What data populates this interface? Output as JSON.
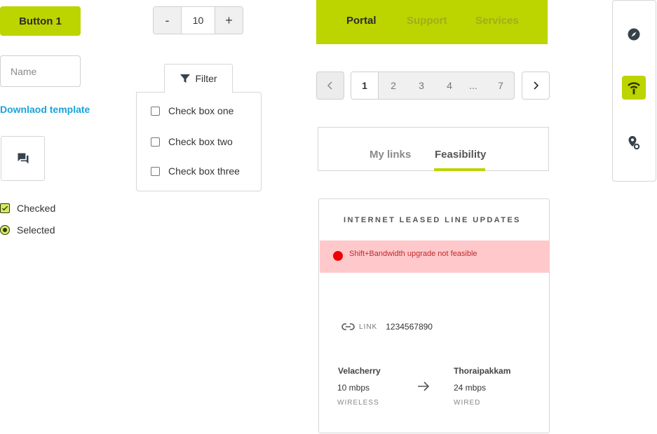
{
  "buttons": {
    "button1": "Button 1"
  },
  "name_field": {
    "placeholder": "Name",
    "value": ""
  },
  "download_link": "Downlaod template",
  "checkbox": {
    "label": "Checked",
    "checked": true
  },
  "radio": {
    "label": "Selected",
    "selected": true
  },
  "stepper": {
    "minus": "-",
    "value": "10",
    "plus": "+"
  },
  "filter": {
    "label": "Filter",
    "options": [
      {
        "label": "Check box one",
        "checked": false
      },
      {
        "label": "Check box two",
        "checked": false
      },
      {
        "label": "Check box three",
        "checked": false
      }
    ]
  },
  "topnav": {
    "items": [
      "Portal",
      "Support",
      "Services"
    ],
    "active": "Portal"
  },
  "pagination": {
    "pages": [
      "1",
      "2",
      "3",
      "4",
      "...",
      "7"
    ],
    "current": "1"
  },
  "tabs": {
    "items": [
      "My links",
      "Feasibility"
    ],
    "active": "Feasibility"
  },
  "card": {
    "title": "INTERNET LEASED LINE UPDATES",
    "alert": "Shift+Bandwidth upgrade not feasible",
    "link_label": "LINK",
    "link_number": "1234567890",
    "from": {
      "name": "Velacherry",
      "speed": "10 mbps",
      "type": "WIRELESS"
    },
    "to": {
      "name": "Thoraipakkam",
      "speed": "24 mbps",
      "type": "WIRED"
    }
  },
  "sidebar": {
    "icons": [
      "compass-icon",
      "wifi-signal-icon",
      "location-pin-icon"
    ],
    "active": "wifi-signal-icon"
  },
  "colors": {
    "accent": "#bcd400",
    "link": "#1aa3d9",
    "alert_bg": "#ffc9cb",
    "alert_dot": "#ee0000"
  }
}
